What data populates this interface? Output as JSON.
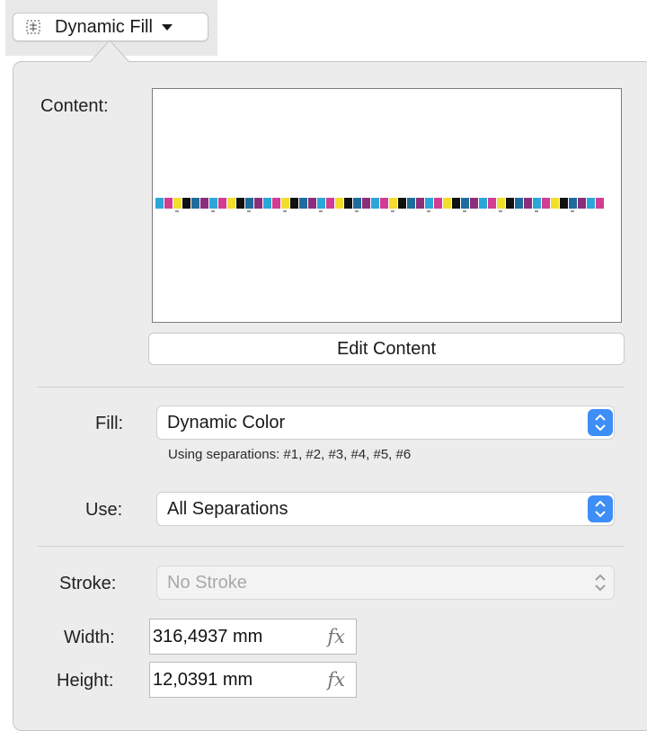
{
  "header": {
    "menu_label": "Dynamic Fill",
    "icon": "dynamic-fill-icon"
  },
  "content": {
    "label": "Content:",
    "edit_button": "Edit Content",
    "strip_colors": [
      "#2aa7d8",
      "#d23c93",
      "#f2de2c",
      "#111111",
      "#1e6c9c",
      "#8b2e7c"
    ]
  },
  "fill": {
    "label": "Fill:",
    "value": "Dynamic Color",
    "hint": "Using separations: #1, #2, #3, #4, #5, #6"
  },
  "use": {
    "label": "Use:",
    "value": "All Separations"
  },
  "stroke": {
    "label": "Stroke:",
    "value": "No Stroke"
  },
  "width": {
    "label": "Width:",
    "value": "316,4937 mm",
    "fx": "fx"
  },
  "height": {
    "label": "Height:",
    "value": "12,0391 mm",
    "fx": "fx"
  },
  "colors": {
    "accent": "#3d8ef6",
    "panel": "#ececec"
  }
}
